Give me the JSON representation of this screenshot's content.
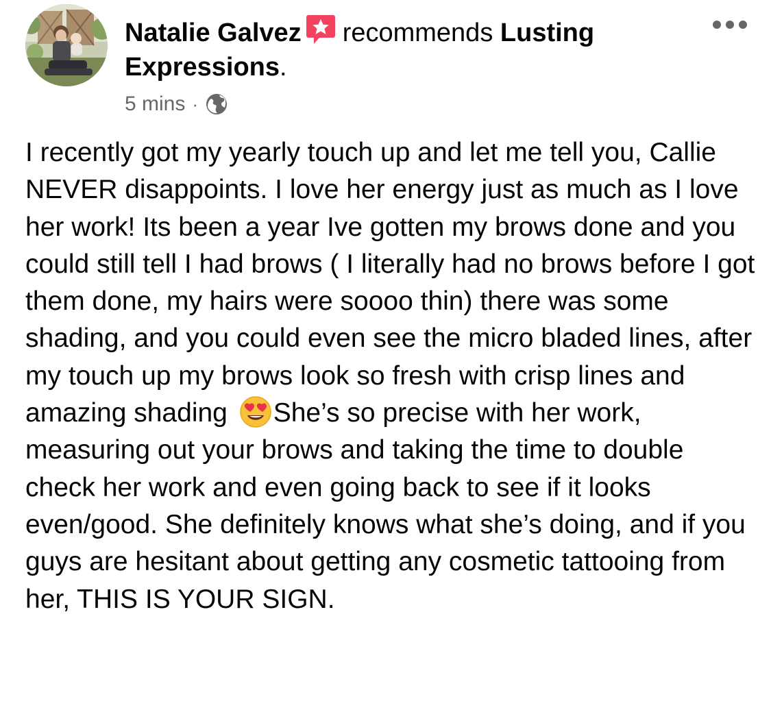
{
  "author": {
    "name": "Natalie Galvez",
    "avatar": "profile-photo",
    "badge_icon": "recommend-star-icon"
  },
  "headline": {
    "verb": "recommends",
    "page_name_part1": "Lusting",
    "page_name_part2": "Expressions",
    "period": "."
  },
  "meta": {
    "timestamp": "5 mins",
    "separator": "·",
    "privacy_icon": "globe-icon"
  },
  "menu": {
    "icon": "more-options-icon"
  },
  "review": {
    "text_before_emoji": "I recently got my yearly touch up and let me tell you, Callie NEVER disappoints. I love her energy just as much as I love her work! Its been a year Ive gotten my brows done and you could still tell I had brows ( I literally had no brows before I got them done, my hairs were soooo thin) there was some shading, and you could even see the micro bladed lines, after my touch up my brows look so fresh with crisp lines  and amazing shading",
    "emoji": "heart-eyes-emoji",
    "text_after_emoji": "She’s so precise with her work, measuring out your brows and taking the time to double check her work and even going back to see if it looks even/good. She definitely knows what she’s doing, and if you guys are hesitant about getting any cosmetic tattooing from her, THIS IS YOUR SIGN."
  },
  "colors": {
    "text": "#050505",
    "secondary_text": "#65676b",
    "badge_red": "#f3425f"
  }
}
